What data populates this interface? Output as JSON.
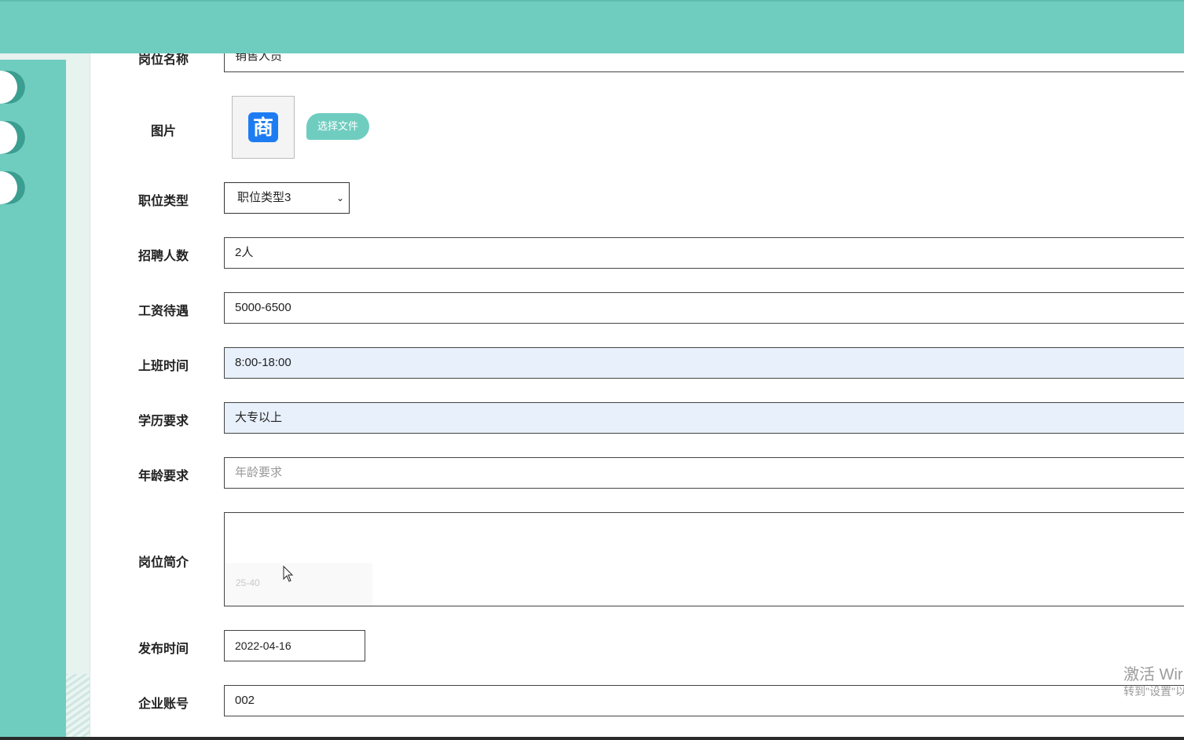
{
  "form": {
    "position_name": {
      "label": "岗位名称",
      "value": "销售人员"
    },
    "image": {
      "label": "图片",
      "logo_glyph": "商",
      "choose_file_label": "选择文件"
    },
    "job_type": {
      "label": "职位类型",
      "value": "职位类型3"
    },
    "headcount": {
      "label": "招聘人数",
      "value": "2人"
    },
    "salary": {
      "label": "工资待遇",
      "value": "5000-6500"
    },
    "work_hours": {
      "label": "上班时间",
      "value": "8:00-18:00"
    },
    "education": {
      "label": "学历要求",
      "value": "大专以上"
    },
    "age": {
      "label": "年龄要求",
      "placeholder": "年龄要求"
    },
    "description": {
      "label": "岗位简介",
      "autocomplete_hint": "25-40"
    },
    "publish_date": {
      "label": "发布时间",
      "value": "2022-04-16"
    },
    "company_account": {
      "label": "企业账号",
      "value": "002"
    }
  },
  "watermark": {
    "line1": "激活 Wir",
    "line2": "转到\"设置\"以"
  },
  "colors": {
    "accent": "#6fcdc0",
    "highlight": "#e8f0fb"
  }
}
